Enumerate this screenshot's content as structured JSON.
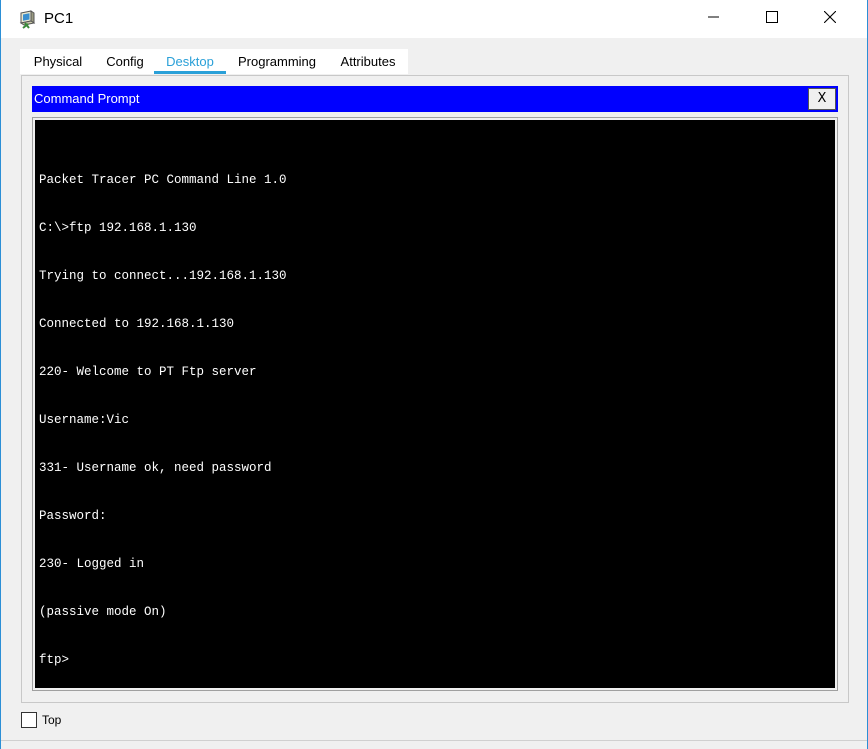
{
  "window": {
    "title": "PC1",
    "icon": "packet-tracer-pc-icon",
    "minimize_icon": "minimize-icon",
    "maximize_icon": "maximize-icon",
    "close_icon": "close-icon"
  },
  "tabs": [
    {
      "label": "Physical",
      "active": false
    },
    {
      "label": "Config",
      "active": false
    },
    {
      "label": "Desktop",
      "active": true
    },
    {
      "label": "Programming",
      "active": false
    },
    {
      "label": "Attributes",
      "active": false
    }
  ],
  "command_prompt": {
    "title": "Command Prompt",
    "close_label": "X",
    "lines": [
      "Packet Tracer PC Command Line 1.0",
      "C:\\>ftp 192.168.1.130",
      "Trying to connect...192.168.1.130",
      "Connected to 192.168.1.130",
      "220- Welcome to PT Ftp server",
      "Username:Vic",
      "331- Username ok, need password",
      "Password:",
      "230- Logged in",
      "(passive mode On)",
      "ftp>"
    ]
  },
  "footer": {
    "top_label": "Top",
    "top_checked": false
  },
  "colors": {
    "accent": "#2aa0d8",
    "cmd_titlebar": "#0000ff",
    "terminal_bg": "#000000",
    "terminal_fg": "#ffffff"
  }
}
